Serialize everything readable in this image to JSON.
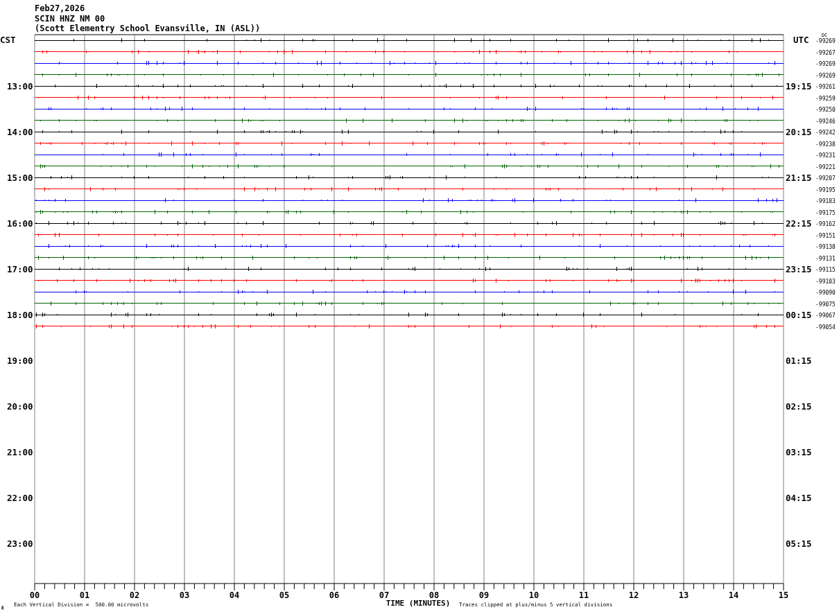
{
  "header": {
    "date": "Feb27,2026",
    "station": "SCIN HNZ NM 00",
    "location": "(Scott Elementry School Evansville, IN (ASL))"
  },
  "left_axis_title": "CST",
  "right_axis_title": "UTC",
  "dc_title": "DC",
  "hour_rows": [
    {
      "local": "13:00",
      "utc": "19:15"
    },
    {
      "local": "14:00",
      "utc": "20:15"
    },
    {
      "local": "15:00",
      "utc": "21:15"
    },
    {
      "local": "16:00",
      "utc": "22:15"
    },
    {
      "local": "17:00",
      "utc": "23:15"
    },
    {
      "local": "18:00",
      "utc": "00:15"
    },
    {
      "local": "19:00",
      "utc": "01:15"
    },
    {
      "local": "20:00",
      "utc": "02:15"
    },
    {
      "local": "21:00",
      "utc": "03:15"
    },
    {
      "local": "22:00",
      "utc": "04:15"
    },
    {
      "local": "23:00",
      "utc": "05:15"
    }
  ],
  "traces": [
    {
      "dc": "-99269",
      "color": "#000000"
    },
    {
      "dc": "-99267",
      "color": "#ff0000"
    },
    {
      "dc": "-99269",
      "color": "#0000ff"
    },
    {
      "dc": "-99269",
      "color": "#006400"
    },
    {
      "dc": "-99261",
      "color": "#000000"
    },
    {
      "dc": "-99259",
      "color": "#ff0000"
    },
    {
      "dc": "-99250",
      "color": "#0000ff"
    },
    {
      "dc": "-99246",
      "color": "#006400"
    },
    {
      "dc": "-99242",
      "color": "#000000"
    },
    {
      "dc": "-99238",
      "color": "#ff0000"
    },
    {
      "dc": "-99231",
      "color": "#0000ff"
    },
    {
      "dc": "-99221",
      "color": "#006400"
    },
    {
      "dc": "-99207",
      "color": "#000000"
    },
    {
      "dc": "-99195",
      "color": "#ff0000"
    },
    {
      "dc": "-99183",
      "color": "#0000ff"
    },
    {
      "dc": "-99175",
      "color": "#006400"
    },
    {
      "dc": "-99162",
      "color": "#000000"
    },
    {
      "dc": "-99151",
      "color": "#ff0000"
    },
    {
      "dc": "-99138",
      "color": "#0000ff"
    },
    {
      "dc": "-99131",
      "color": "#006400"
    },
    {
      "dc": "-99115",
      "color": "#000000"
    },
    {
      "dc": "-99103",
      "color": "#ff0000"
    },
    {
      "dc": "-99090",
      "color": "#0000ff"
    },
    {
      "dc": "-99075",
      "color": "#006400"
    },
    {
      "dc": "-99067",
      "color": "#000000"
    },
    {
      "dc": "-99054",
      "color": "#ff0000"
    }
  ],
  "x_ticks": [
    "00",
    "01",
    "02",
    "03",
    "04",
    "05",
    "06",
    "07",
    "08",
    "09",
    "10",
    "11",
    "12",
    "13",
    "14",
    "15"
  ],
  "xlabel": "TIME (MINUTES)",
  "footer": {
    "scale_note": "Each Vertical Division =  500.00 microvolts",
    "clip_note": "Traces clipped at plus/minus 5 vertical divisions"
  }
}
